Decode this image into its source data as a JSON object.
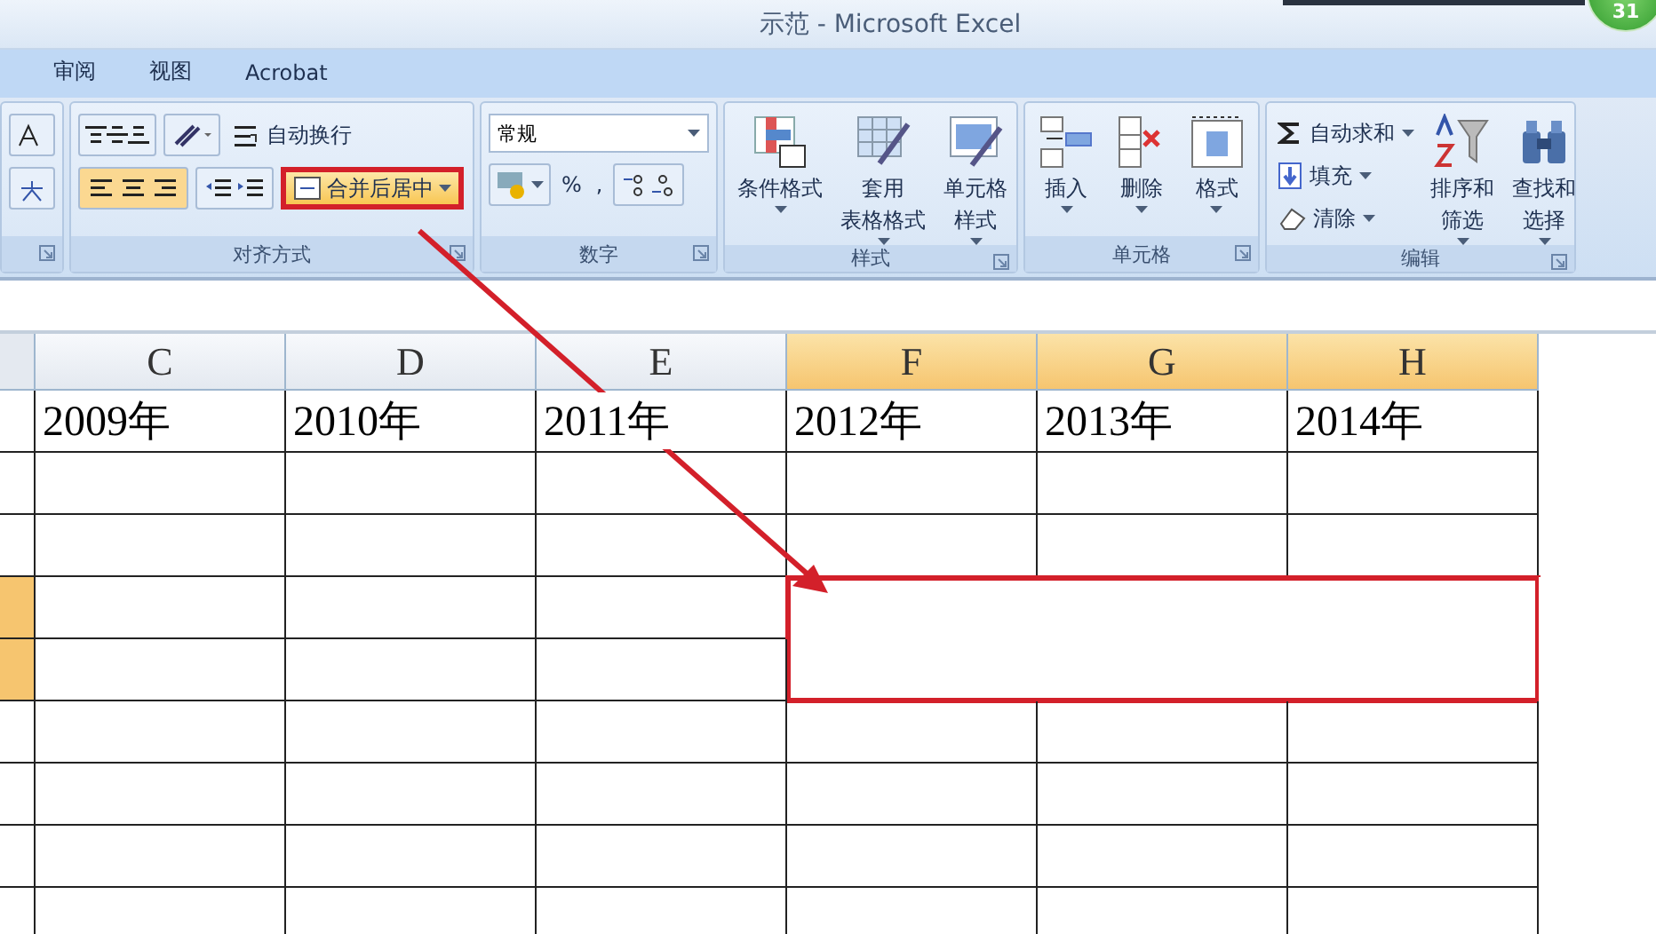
{
  "window": {
    "title": "示范 - Microsoft Excel",
    "badge": "31"
  },
  "tabs": [
    {
      "label": "审阅",
      "selected": false
    },
    {
      "label": "视图",
      "selected": false
    },
    {
      "label": "Acrobat",
      "selected": false
    }
  ],
  "alignment": {
    "wrap": "自动换行",
    "merge": {
      "label": "合并后居中",
      "highlighted": true
    },
    "label": "对齐方式"
  },
  "number": {
    "format": "常规",
    "percent": "%",
    "comma": ",",
    "label": "数字"
  },
  "styles": {
    "buttons": [
      {
        "lines": [
          "条件格式"
        ],
        "kind": "conditional"
      },
      {
        "lines": [
          "套用",
          "表格格式"
        ],
        "kind": "table"
      },
      {
        "lines": [
          "单元格",
          "样式"
        ],
        "kind": "cellstyle"
      }
    ],
    "label": "样式"
  },
  "cells": {
    "buttons": [
      {
        "label": "插入",
        "kind": "insert"
      },
      {
        "label": "删除",
        "kind": "delete"
      },
      {
        "label": "格式",
        "kind": "format"
      }
    ],
    "label": "单元格"
  },
  "editing": {
    "small": [
      {
        "label": "自动求和",
        "kind": "sum"
      },
      {
        "label": "填充",
        "kind": "fill"
      },
      {
        "label": "清除",
        "kind": "clear"
      }
    ],
    "big": [
      {
        "lines": [
          "排序和",
          "筛选"
        ],
        "kind": "sort"
      },
      {
        "lines": [
          "查找和",
          "选择"
        ],
        "kind": "find"
      }
    ],
    "label": "编辑"
  },
  "columns": [
    {
      "label": "C",
      "selected": false
    },
    {
      "label": "D",
      "selected": false
    },
    {
      "label": "E",
      "selected": false
    },
    {
      "label": "F",
      "selected": true
    },
    {
      "label": "G",
      "selected": true
    },
    {
      "label": "H",
      "selected": true
    }
  ],
  "rows": [
    {
      "cells": [
        "2009年",
        "2010年",
        "2011年",
        "2012年",
        "2013年",
        "2014年"
      ],
      "selected": false
    },
    {
      "selected": false
    },
    {
      "selected": false
    },
    {
      "selected": true
    },
    {
      "selected": true
    },
    {
      "selected": false
    },
    {
      "selected": false
    },
    {
      "selected": false
    },
    {
      "selected": false
    }
  ]
}
